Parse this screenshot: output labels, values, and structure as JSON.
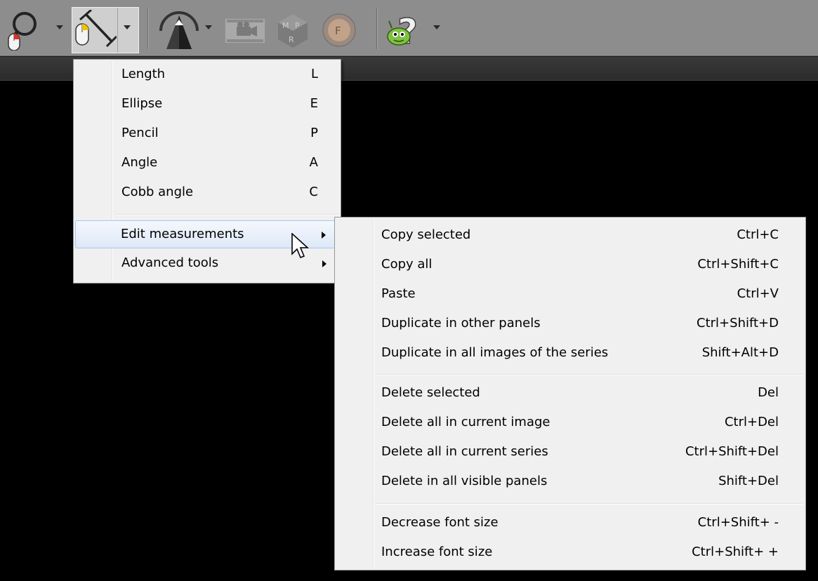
{
  "toolbar": {
    "icons": [
      "magnifier-icon",
      "measure-tool-icon",
      "3d-tool-icon",
      "cine-film-icon",
      "mpr-icon",
      "fusion-icon",
      "help-icon"
    ]
  },
  "measure_menu": {
    "items": [
      {
        "label": "Length",
        "shortcut": "L"
      },
      {
        "label": "Ellipse",
        "shortcut": "E"
      },
      {
        "label": "Pencil",
        "shortcut": "P"
      },
      {
        "label": "Angle",
        "shortcut": "A"
      },
      {
        "label": "Cobb angle",
        "shortcut": "C"
      }
    ],
    "submenus": [
      {
        "label": "Edit measurements"
      },
      {
        "label": "Advanced tools"
      }
    ]
  },
  "edit_submenu": {
    "groups": [
      [
        {
          "label": "Copy selected",
          "shortcut": "Ctrl+C"
        },
        {
          "label": "Copy all",
          "shortcut": "Ctrl+Shift+C"
        },
        {
          "label": "Paste",
          "shortcut": "Ctrl+V"
        },
        {
          "label": "Duplicate in other panels",
          "shortcut": "Ctrl+Shift+D"
        },
        {
          "label": "Duplicate in all images of the series",
          "shortcut": "Shift+Alt+D"
        }
      ],
      [
        {
          "label": "Delete selected",
          "shortcut": "Del"
        },
        {
          "label": "Delete all in current image",
          "shortcut": "Ctrl+Del"
        },
        {
          "label": "Delete all in current series",
          "shortcut": "Ctrl+Shift+Del"
        },
        {
          "label": "Delete in all visible panels",
          "shortcut": "Shift+Del"
        }
      ],
      [
        {
          "label": "Decrease font size",
          "shortcut": "Ctrl+Shift+ -"
        },
        {
          "label": "Increase font size",
          "shortcut": "Ctrl+Shift+ +"
        }
      ]
    ]
  }
}
